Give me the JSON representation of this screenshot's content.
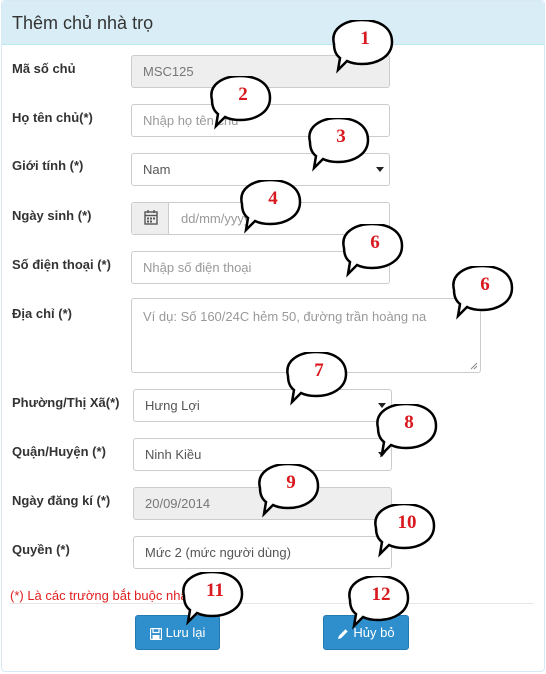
{
  "form": {
    "title": "Thêm chủ nhà trọ",
    "fields": {
      "owner_code": {
        "label": "Mã số chủ",
        "value": "MSC125"
      },
      "full_name": {
        "label": "Họ tên chủ(*)",
        "placeholder": "Nhập họ tên chủ"
      },
      "gender": {
        "label": "Giới tính (*)",
        "value": "Nam"
      },
      "birth_date": {
        "label": "Ngày sinh (*)",
        "placeholder": "dd/mm/yyyy"
      },
      "phone": {
        "label": "Số điện thoại (*)",
        "placeholder": "Nhập số điện thoại"
      },
      "address": {
        "label": "Địa chỉ (*)",
        "placeholder": "Ví dụ: Số 160/24C hẻm 50, đường trần hoàng na"
      },
      "ward": {
        "label": "Phường/Thị Xã(*)",
        "value": "Hưng Lợi"
      },
      "district": {
        "label": "Quận/Huyện (*)",
        "value": "Ninh Kiều"
      },
      "register_date": {
        "label": "Ngày đăng kí (*)",
        "value": "20/09/2014"
      },
      "role": {
        "label": "Quyền (*)",
        "value": "Mức 2 (mức người dùng)"
      }
    },
    "required_note": "(*) Là các trường bắt buộc nhập",
    "buttons": {
      "save": "Lưu lại",
      "cancel": "Hủy bỏ"
    }
  },
  "callouts": [
    "1",
    "2",
    "3",
    "4",
    "6",
    "6",
    "7",
    "8",
    "9",
    "10",
    "11",
    "12"
  ],
  "colors": {
    "header_bg": "#d9edf7",
    "button_primary": "#2f8fcc",
    "callout_number": "#d8191f",
    "required_text": "#e02020"
  },
  "icons": {
    "calendar": "calendar-icon",
    "save": "floppy-disk-icon",
    "cancel": "pencil-icon"
  }
}
